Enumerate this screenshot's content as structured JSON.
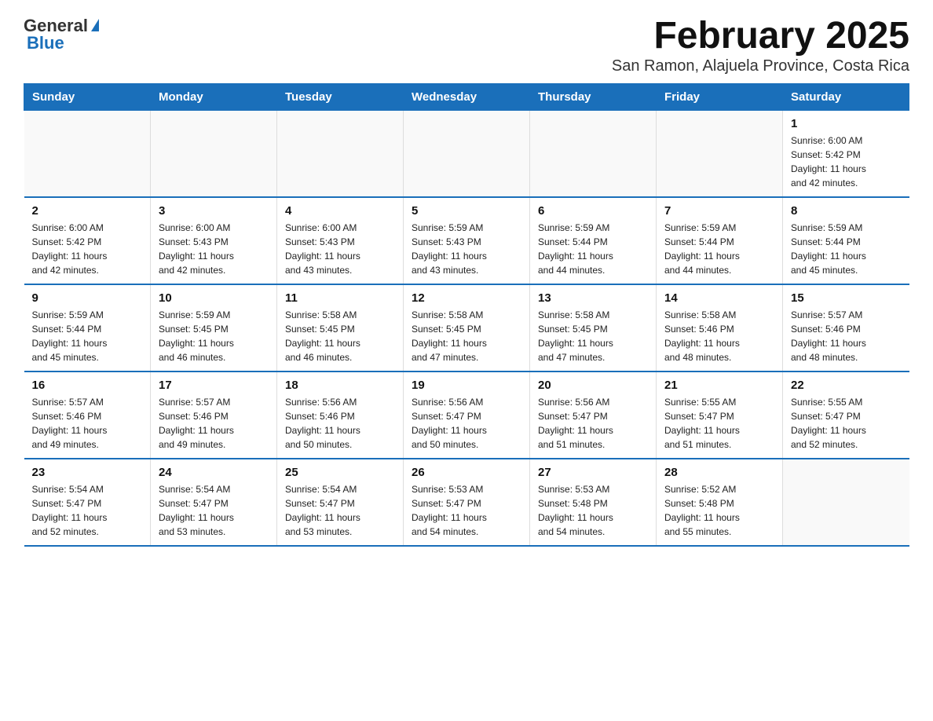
{
  "logo": {
    "general": "General",
    "blue": "Blue"
  },
  "title": "February 2025",
  "subtitle": "San Ramon, Alajuela Province, Costa Rica",
  "weekdays": [
    "Sunday",
    "Monday",
    "Tuesday",
    "Wednesday",
    "Thursday",
    "Friday",
    "Saturday"
  ],
  "weeks": [
    [
      {
        "day": "",
        "info": ""
      },
      {
        "day": "",
        "info": ""
      },
      {
        "day": "",
        "info": ""
      },
      {
        "day": "",
        "info": ""
      },
      {
        "day": "",
        "info": ""
      },
      {
        "day": "",
        "info": ""
      },
      {
        "day": "1",
        "info": "Sunrise: 6:00 AM\nSunset: 5:42 PM\nDaylight: 11 hours\nand 42 minutes."
      }
    ],
    [
      {
        "day": "2",
        "info": "Sunrise: 6:00 AM\nSunset: 5:42 PM\nDaylight: 11 hours\nand 42 minutes."
      },
      {
        "day": "3",
        "info": "Sunrise: 6:00 AM\nSunset: 5:43 PM\nDaylight: 11 hours\nand 42 minutes."
      },
      {
        "day": "4",
        "info": "Sunrise: 6:00 AM\nSunset: 5:43 PM\nDaylight: 11 hours\nand 43 minutes."
      },
      {
        "day": "5",
        "info": "Sunrise: 5:59 AM\nSunset: 5:43 PM\nDaylight: 11 hours\nand 43 minutes."
      },
      {
        "day": "6",
        "info": "Sunrise: 5:59 AM\nSunset: 5:44 PM\nDaylight: 11 hours\nand 44 minutes."
      },
      {
        "day": "7",
        "info": "Sunrise: 5:59 AM\nSunset: 5:44 PM\nDaylight: 11 hours\nand 44 minutes."
      },
      {
        "day": "8",
        "info": "Sunrise: 5:59 AM\nSunset: 5:44 PM\nDaylight: 11 hours\nand 45 minutes."
      }
    ],
    [
      {
        "day": "9",
        "info": "Sunrise: 5:59 AM\nSunset: 5:44 PM\nDaylight: 11 hours\nand 45 minutes."
      },
      {
        "day": "10",
        "info": "Sunrise: 5:59 AM\nSunset: 5:45 PM\nDaylight: 11 hours\nand 46 minutes."
      },
      {
        "day": "11",
        "info": "Sunrise: 5:58 AM\nSunset: 5:45 PM\nDaylight: 11 hours\nand 46 minutes."
      },
      {
        "day": "12",
        "info": "Sunrise: 5:58 AM\nSunset: 5:45 PM\nDaylight: 11 hours\nand 47 minutes."
      },
      {
        "day": "13",
        "info": "Sunrise: 5:58 AM\nSunset: 5:45 PM\nDaylight: 11 hours\nand 47 minutes."
      },
      {
        "day": "14",
        "info": "Sunrise: 5:58 AM\nSunset: 5:46 PM\nDaylight: 11 hours\nand 48 minutes."
      },
      {
        "day": "15",
        "info": "Sunrise: 5:57 AM\nSunset: 5:46 PM\nDaylight: 11 hours\nand 48 minutes."
      }
    ],
    [
      {
        "day": "16",
        "info": "Sunrise: 5:57 AM\nSunset: 5:46 PM\nDaylight: 11 hours\nand 49 minutes."
      },
      {
        "day": "17",
        "info": "Sunrise: 5:57 AM\nSunset: 5:46 PM\nDaylight: 11 hours\nand 49 minutes."
      },
      {
        "day": "18",
        "info": "Sunrise: 5:56 AM\nSunset: 5:46 PM\nDaylight: 11 hours\nand 50 minutes."
      },
      {
        "day": "19",
        "info": "Sunrise: 5:56 AM\nSunset: 5:47 PM\nDaylight: 11 hours\nand 50 minutes."
      },
      {
        "day": "20",
        "info": "Sunrise: 5:56 AM\nSunset: 5:47 PM\nDaylight: 11 hours\nand 51 minutes."
      },
      {
        "day": "21",
        "info": "Sunrise: 5:55 AM\nSunset: 5:47 PM\nDaylight: 11 hours\nand 51 minutes."
      },
      {
        "day": "22",
        "info": "Sunrise: 5:55 AM\nSunset: 5:47 PM\nDaylight: 11 hours\nand 52 minutes."
      }
    ],
    [
      {
        "day": "23",
        "info": "Sunrise: 5:54 AM\nSunset: 5:47 PM\nDaylight: 11 hours\nand 52 minutes."
      },
      {
        "day": "24",
        "info": "Sunrise: 5:54 AM\nSunset: 5:47 PM\nDaylight: 11 hours\nand 53 minutes."
      },
      {
        "day": "25",
        "info": "Sunrise: 5:54 AM\nSunset: 5:47 PM\nDaylight: 11 hours\nand 53 minutes."
      },
      {
        "day": "26",
        "info": "Sunrise: 5:53 AM\nSunset: 5:47 PM\nDaylight: 11 hours\nand 54 minutes."
      },
      {
        "day": "27",
        "info": "Sunrise: 5:53 AM\nSunset: 5:48 PM\nDaylight: 11 hours\nand 54 minutes."
      },
      {
        "day": "28",
        "info": "Sunrise: 5:52 AM\nSunset: 5:48 PM\nDaylight: 11 hours\nand 55 minutes."
      },
      {
        "day": "",
        "info": ""
      }
    ]
  ]
}
